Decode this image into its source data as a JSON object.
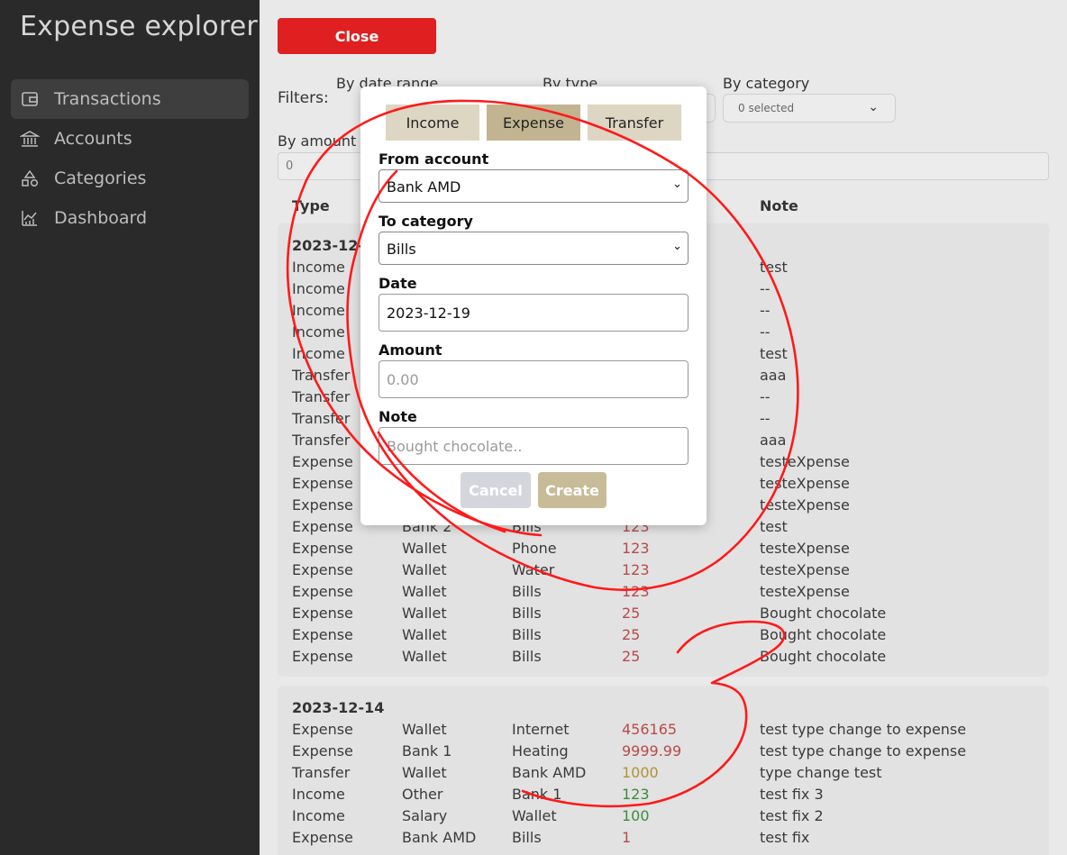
{
  "app": {
    "title": "Expense explorer"
  },
  "sidebar": {
    "items": [
      {
        "label": "Transactions",
        "icon": "wallet-icon",
        "active": true
      },
      {
        "label": "Accounts",
        "icon": "bank-icon",
        "active": false
      },
      {
        "label": "Categories",
        "icon": "shapes-icon",
        "active": false
      },
      {
        "label": "Dashboard",
        "icon": "chart-icon",
        "active": false
      }
    ]
  },
  "toolbar": {
    "close_label": "Close"
  },
  "filters": {
    "label": "Filters:",
    "by_date_label": "By date range",
    "by_type_label": "By type",
    "by_category_label": "By category",
    "category_value": "0 selected",
    "by_amount_label": "By amount r",
    "amount_value": "0"
  },
  "table": {
    "headers": {
      "type": "Type",
      "note": "Note"
    },
    "groups": [
      {
        "date": "2023-12-1",
        "rows": [
          {
            "type": "Income",
            "from": "",
            "to": "",
            "amount": "",
            "kind": "inc",
            "note": "test"
          },
          {
            "type": "Income",
            "from": "",
            "to": "",
            "amount": "",
            "kind": "inc",
            "note": "--"
          },
          {
            "type": "Income",
            "from": "",
            "to": "",
            "amount": "",
            "kind": "inc",
            "note": "--"
          },
          {
            "type": "Income",
            "from": "",
            "to": "",
            "amount": "",
            "kind": "inc",
            "note": "--"
          },
          {
            "type": "Income",
            "from": "",
            "to": "",
            "amount": "",
            "kind": "inc",
            "note": "test"
          },
          {
            "type": "Transfer",
            "from": "",
            "to": "",
            "amount": "",
            "kind": "trf",
            "note": "aaa"
          },
          {
            "type": "Transfer",
            "from": "",
            "to": "",
            "amount": "",
            "kind": "trf",
            "note": "--"
          },
          {
            "type": "Transfer",
            "from": "",
            "to": "",
            "amount": "",
            "kind": "trf",
            "note": "--"
          },
          {
            "type": "Transfer",
            "from": "",
            "to": "",
            "amount": "",
            "kind": "trf",
            "note": "aaa"
          },
          {
            "type": "Expense",
            "from": "",
            "to": "",
            "amount": "",
            "kind": "exp",
            "note": "testeXpense"
          },
          {
            "type": "Expense",
            "from": "",
            "to": "",
            "amount": "",
            "kind": "exp",
            "note": "testeXpense"
          },
          {
            "type": "Expense",
            "from": "",
            "to": "",
            "amount": "",
            "kind": "exp",
            "note": "testeXpense"
          },
          {
            "type": "Expense",
            "from": "Bank 2",
            "to": "Bills",
            "amount": "123",
            "kind": "exp",
            "note": "test"
          },
          {
            "type": "Expense",
            "from": "Wallet",
            "to": "Phone",
            "amount": "123",
            "kind": "exp",
            "note": "testeXpense"
          },
          {
            "type": "Expense",
            "from": "Wallet",
            "to": "Water",
            "amount": "123",
            "kind": "exp",
            "note": "testeXpense"
          },
          {
            "type": "Expense",
            "from": "Wallet",
            "to": "Bills",
            "amount": "123",
            "kind": "exp",
            "note": "testeXpense"
          },
          {
            "type": "Expense",
            "from": "Wallet",
            "to": "Bills",
            "amount": "25",
            "kind": "exp",
            "note": "Bought chocolate"
          },
          {
            "type": "Expense",
            "from": "Wallet",
            "to": "Bills",
            "amount": "25",
            "kind": "exp",
            "note": "Bought chocolate"
          },
          {
            "type": "Expense",
            "from": "Wallet",
            "to": "Bills",
            "amount": "25",
            "kind": "exp",
            "note": "Bought chocolate"
          }
        ]
      },
      {
        "date": "2023-12-14",
        "rows": [
          {
            "type": "Expense",
            "from": "Wallet",
            "to": "Internet",
            "amount": "456165",
            "kind": "exp",
            "note": "test type change to expense"
          },
          {
            "type": "Expense",
            "from": "Bank 1",
            "to": "Heating",
            "amount": "9999.99",
            "kind": "exp",
            "note": "test type change to expense"
          },
          {
            "type": "Transfer",
            "from": "Wallet",
            "to": "Bank AMD",
            "amount": "1000",
            "kind": "trf",
            "note": "type change test"
          },
          {
            "type": "Income",
            "from": "Other",
            "to": "Bank 1",
            "amount": "123",
            "kind": "inc",
            "note": "test fix 3"
          },
          {
            "type": "Income",
            "from": "Salary",
            "to": "Wallet",
            "amount": "100",
            "kind": "inc",
            "note": "test fix 2"
          },
          {
            "type": "Expense",
            "from": "Bank AMD",
            "to": "Bills",
            "amount": "1",
            "kind": "exp",
            "note": "test fix"
          }
        ]
      }
    ]
  },
  "modal": {
    "tabs": {
      "income": "Income",
      "expense": "Expense",
      "transfer": "Transfer"
    },
    "from_account_label": "From account",
    "from_account_value": "Bank AMD",
    "to_category_label": "To category",
    "to_category_value": "Bills",
    "date_label": "Date",
    "date_value": "2023-12-19",
    "amount_label": "Amount",
    "amount_placeholder": "0.00",
    "note_label": "Note",
    "note_placeholder": "Bought chocolate..",
    "cancel_label": "Cancel",
    "create_label": "Create"
  },
  "colors": {
    "sidebar_bg": "#2a2a2a",
    "close_button": "#e02020",
    "tab_active": "#c2b490",
    "tab_inactive": "#ddd6c3",
    "annotation_stroke": "#ff0000"
  }
}
